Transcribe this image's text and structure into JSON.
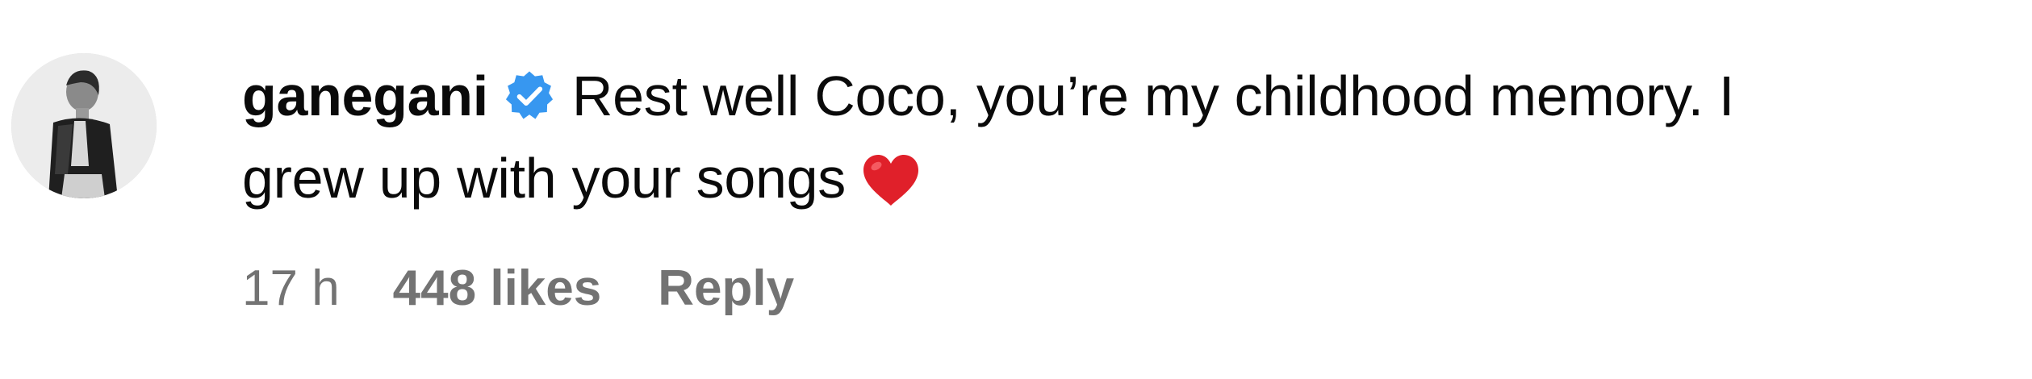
{
  "comment": {
    "avatar_icon": "profile-photo",
    "username": "ganegani",
    "verified_icon": "verified-badge-icon",
    "text_line1": "Rest well Coco, you’re my childhood memory. I",
    "text_line2": "grew up with your songs",
    "emoji": "red-heart-emoji",
    "timestamp": "17 h",
    "likes": "448 likes",
    "reply_label": "Reply"
  },
  "colors": {
    "text": "#0a0a0a",
    "muted": "#737373",
    "verified": "#3797f0",
    "heart": "#e0202a"
  }
}
